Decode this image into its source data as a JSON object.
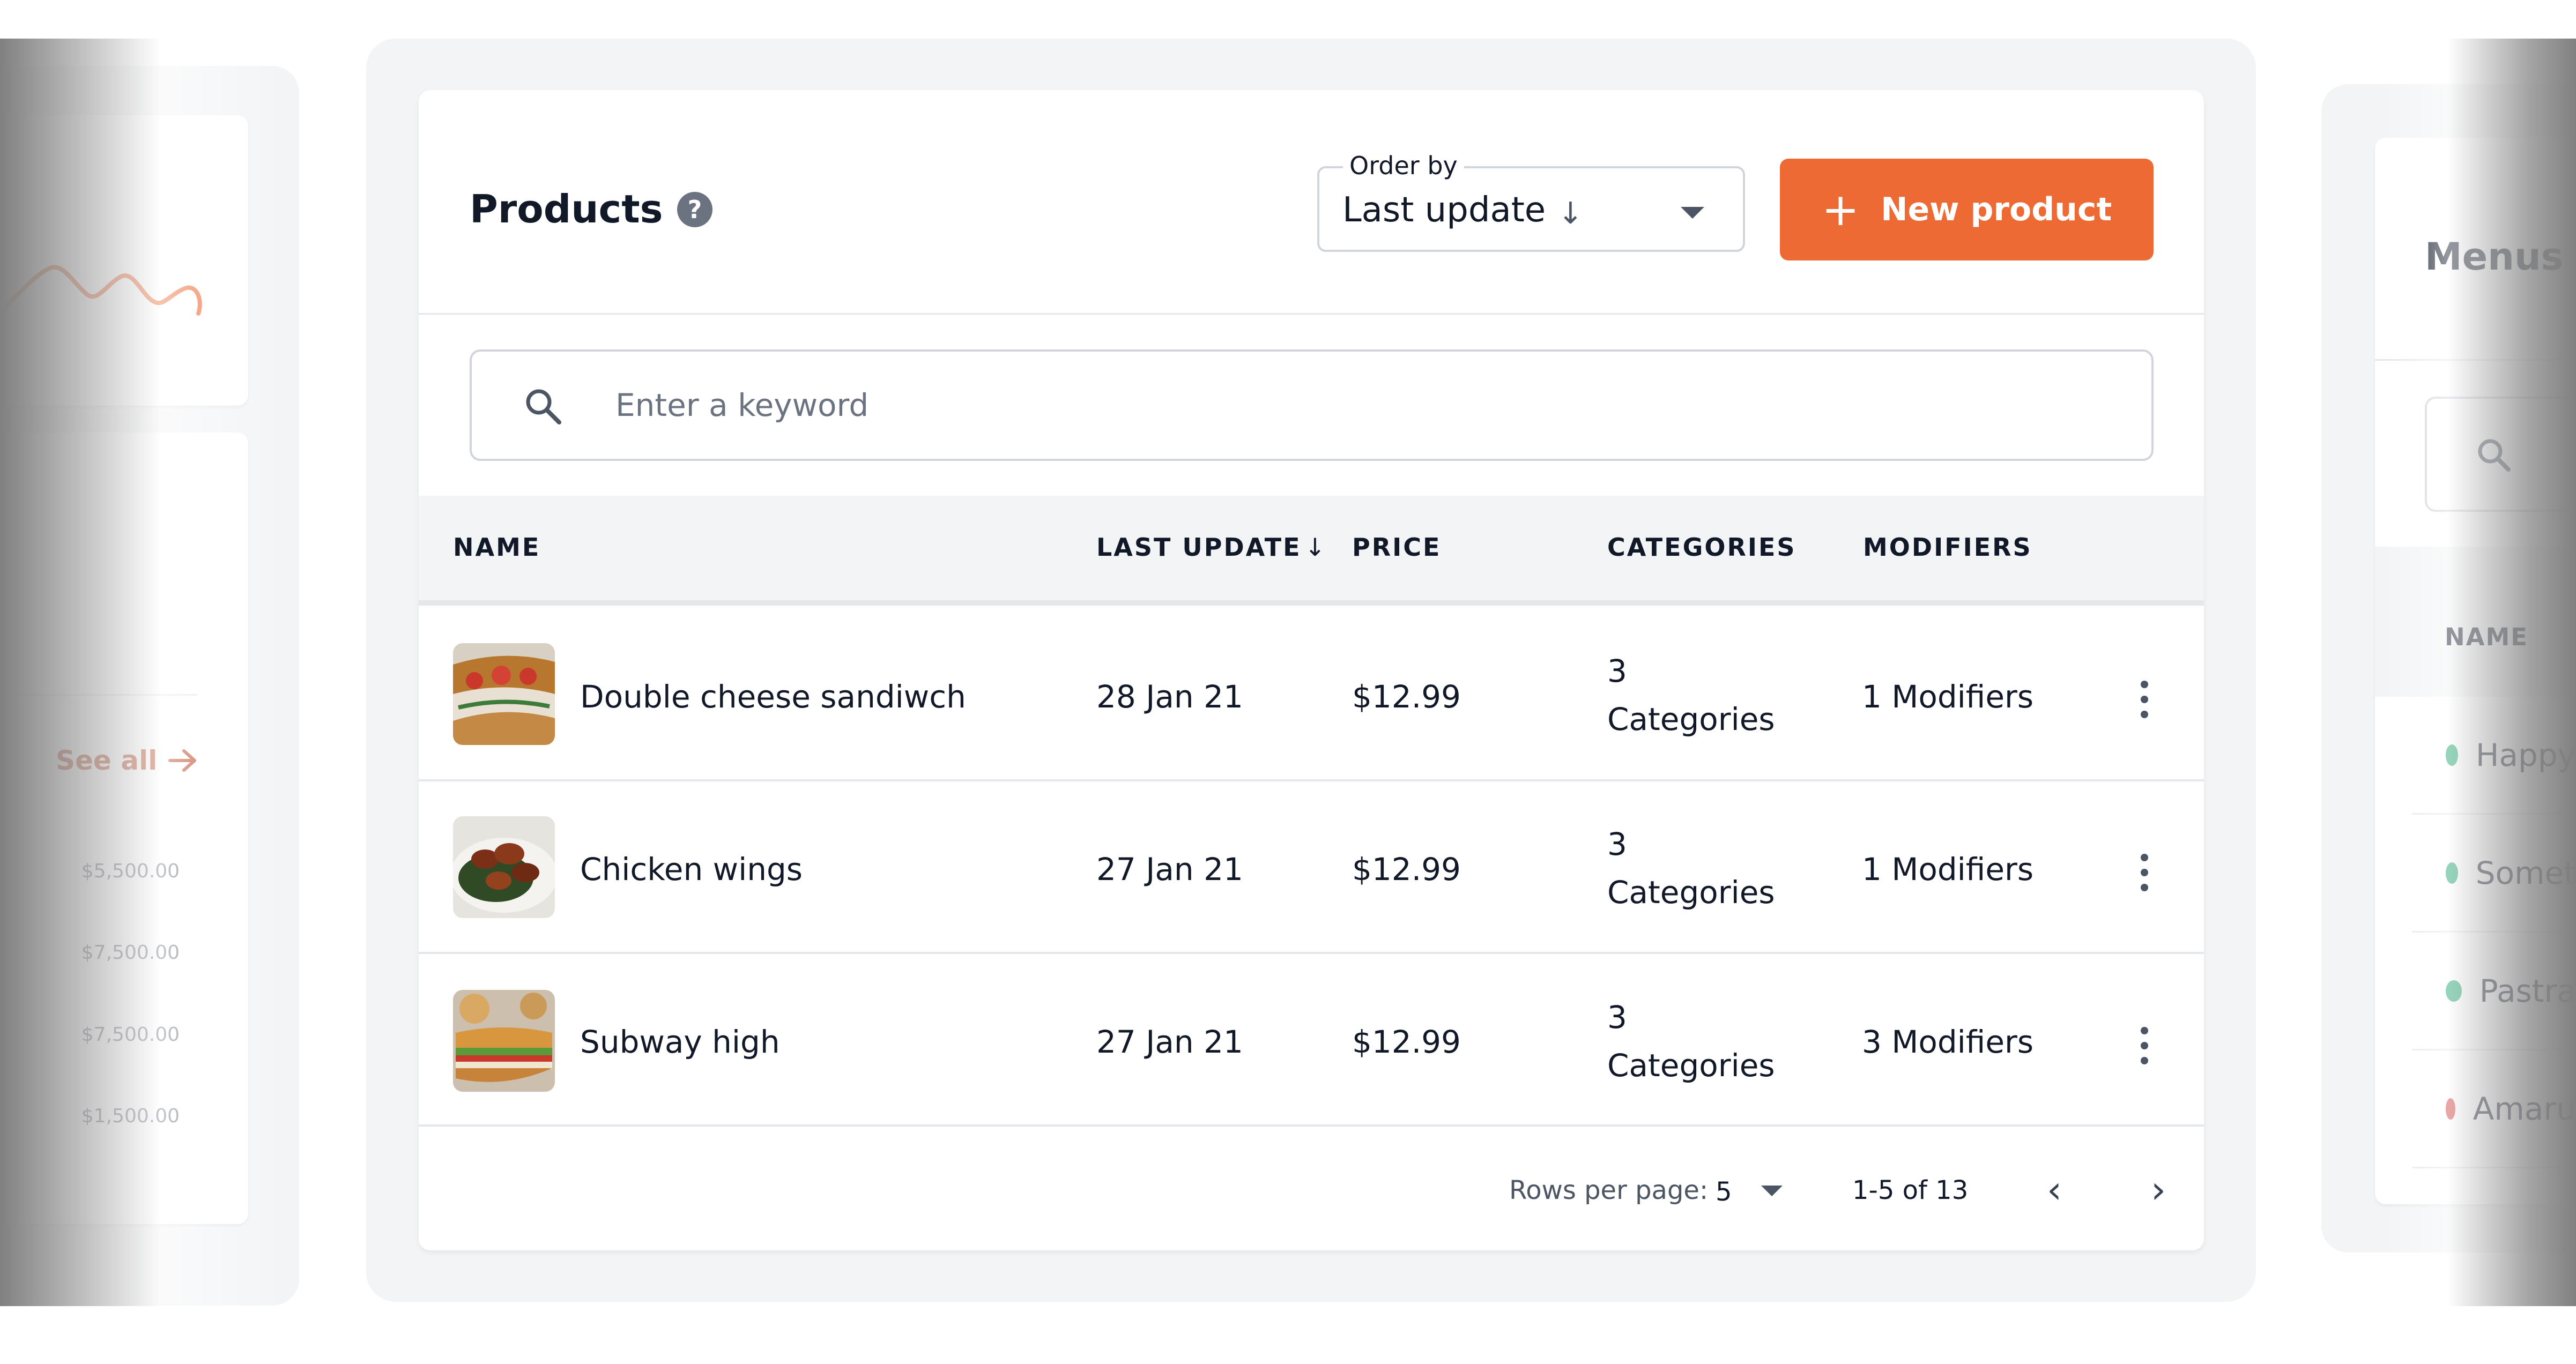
{
  "colors": {
    "accent": "#ee6a34",
    "accent_text": "#b94a25",
    "status_green": "#16a36a",
    "status_red": "#d23b3b",
    "panel_bg": "#f3f4f6"
  },
  "left_panel": {
    "see_all": "See all",
    "axis_values": [
      "$5,500.00",
      "$7,500.00",
      "$7,500.00",
      "$1,500.00"
    ]
  },
  "products": {
    "title": "Products",
    "help_icon": "?",
    "order_by": {
      "label": "Order by",
      "value": "Last update",
      "direction_icon": "↓"
    },
    "new_button": {
      "icon": "+",
      "label": "New product"
    },
    "search": {
      "placeholder": "Enter a keyword",
      "value": ""
    },
    "columns": {
      "name": "NAME",
      "last_update": "LAST UPDATE",
      "sort_icon": "↓",
      "price": "PRICE",
      "categories": "CATEGORIES",
      "modifiers": "MODIFIERS"
    },
    "rows": [
      {
        "name": "Double cheese sandiwch",
        "last_update": "28 Jan 21",
        "price": "$12.99",
        "categories_count": "3",
        "categories_word": "Categories",
        "modifiers": "1 Modifiers",
        "image": "sandwich-photo"
      },
      {
        "name": "Chicken wings",
        "last_update": "27 Jan 21",
        "price": "$12.99",
        "categories_count": "3",
        "categories_word": "Categories",
        "modifiers": "1 Modifiers",
        "image": "wings-photo"
      },
      {
        "name": "Subway high",
        "last_update": "27 Jan 21",
        "price": "$12.99",
        "categories_count": "3",
        "categories_word": "Categories",
        "modifiers": "3 Modifiers",
        "image": "sub-photo"
      }
    ],
    "pagination": {
      "rows_per_page_label": "Rows per page:",
      "rows_per_page": "5",
      "range": "1-5 of 13",
      "prev_icon": "‹",
      "next_icon": "›"
    }
  },
  "menus_panel": {
    "title": "Menus",
    "name_header": "NAME",
    "items": [
      {
        "label": "Happy",
        "status": "green"
      },
      {
        "label": "Somet",
        "status": "green"
      },
      {
        "label": "Pastra",
        "status": "green"
      },
      {
        "label": "Amaru",
        "status": "red"
      }
    ]
  }
}
